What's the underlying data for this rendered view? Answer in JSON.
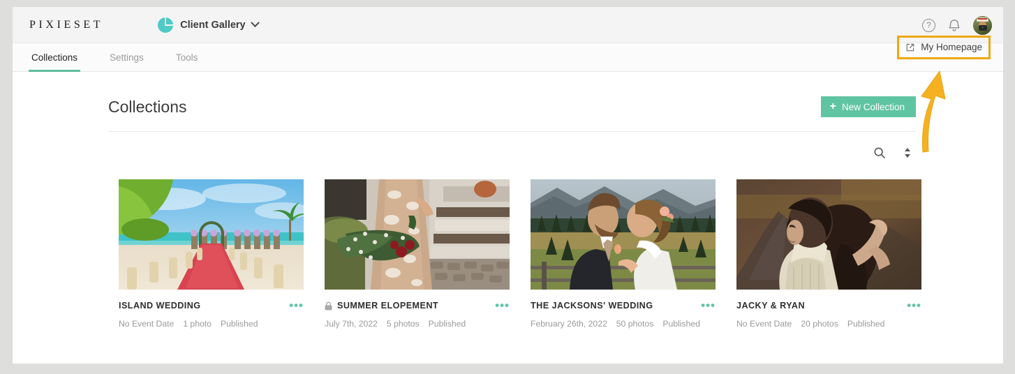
{
  "topbar": {
    "brand": "PIXIESET",
    "app_switcher_label": "Client Gallery",
    "help_icon": "question-mark-circle-icon",
    "notification_icon": "bell-icon",
    "avatar_icon": "user-avatar"
  },
  "nav": {
    "tabs": [
      {
        "label": "Collections",
        "active": true
      },
      {
        "label": "Settings",
        "active": false
      },
      {
        "label": "Tools",
        "active": false
      }
    ],
    "homepage_link": "My Homepage",
    "homepage_icon": "external-link-icon",
    "highlight_color": "#efa713"
  },
  "annotation": {
    "arrow_color": "#f5b120",
    "arrow_target": "My Homepage"
  },
  "page": {
    "title": "Collections",
    "new_collection_label": "New Collection",
    "new_collection_color": "#5fc4a1",
    "search_icon": "search-icon",
    "sort_icon": "sort-icon"
  },
  "collections": [
    {
      "title": "ISLAND WEDDING",
      "locked": false,
      "date": "No Event Date",
      "photos": "1 photo",
      "status": "Published",
      "thumb": "beach-wedding-aisle"
    },
    {
      "title": "SUMMER ELOPEMENT",
      "locked": true,
      "date": "July 7th, 2022",
      "photos": "5 photos",
      "status": "Published",
      "thumb": "bride-holding-bouquet"
    },
    {
      "title": "THE JACKSONS' WEDDING",
      "locked": false,
      "date": "February 26th, 2022",
      "photos": "50 photos",
      "status": "Published",
      "thumb": "couple-mountain-field"
    },
    {
      "title": "JACKY & RYAN",
      "locked": false,
      "date": "No Event Date",
      "photos": "20 photos",
      "status": "Published",
      "thumb": "woman-road-sunset"
    }
  ]
}
